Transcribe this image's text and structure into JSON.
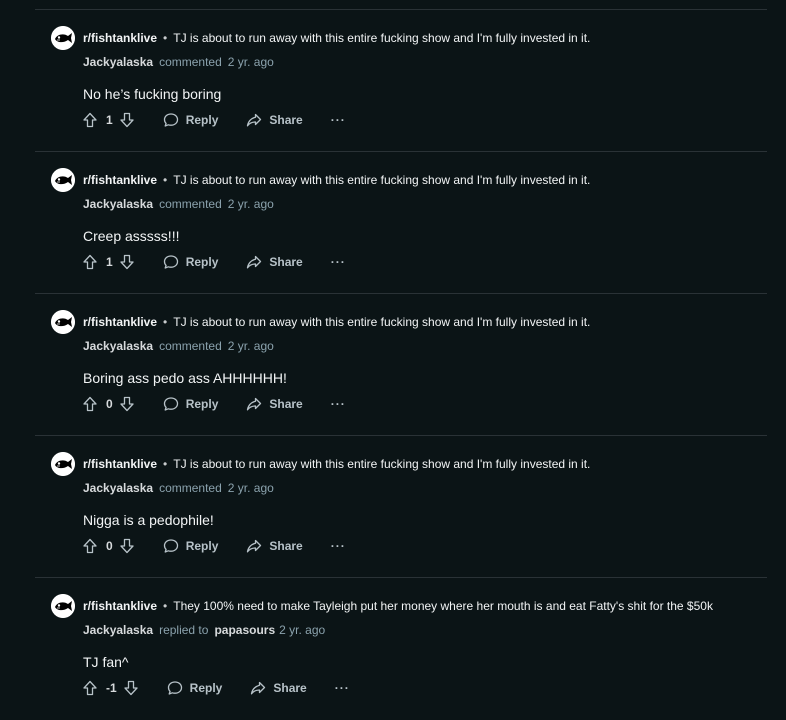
{
  "comments": [
    {
      "subreddit": "r/fishtanklive",
      "post_title": "TJ is about to run away with this entire fucking show and I'm fully invested in it.",
      "author": "Jackyalaska",
      "action": "commented",
      "parent_author": "",
      "time": "2 yr. ago",
      "body": "No he’s fucking boring",
      "score": "1"
    },
    {
      "subreddit": "r/fishtanklive",
      "post_title": "TJ is about to run away with this entire fucking show and I'm fully invested in it.",
      "author": "Jackyalaska",
      "action": "commented",
      "parent_author": "",
      "time": "2 yr. ago",
      "body": "Creep asssss!!!",
      "score": "1"
    },
    {
      "subreddit": "r/fishtanklive",
      "post_title": "TJ is about to run away with this entire fucking show and I'm fully invested in it.",
      "author": "Jackyalaska",
      "action": "commented",
      "parent_author": "",
      "time": "2 yr. ago",
      "body": "Boring ass pedo ass AHHHHHH!",
      "score": "0"
    },
    {
      "subreddit": "r/fishtanklive",
      "post_title": "TJ is about to run away with this entire fucking show and I'm fully invested in it.",
      "author": "Jackyalaska",
      "action": "commented",
      "parent_author": "",
      "time": "2 yr. ago",
      "body": "Nigga is a pedophile!",
      "score": "0"
    },
    {
      "subreddit": "r/fishtanklive",
      "post_title": "They 100% need to make Tayleigh put her money where her mouth is and eat Fatty's shit for the $50k",
      "author": "Jackyalaska",
      "action": "replied to",
      "parent_author": "papasours",
      "time": "2 yr. ago",
      "body": "TJ fan^",
      "score": "-1"
    }
  ],
  "labels": {
    "separator": "•",
    "reply": "Reply",
    "share": "Share",
    "more": "···"
  },
  "icons": {
    "avatar": "fish-avatar-icon",
    "upvote": "upvote-arrow-icon",
    "downvote": "downvote-arrow-icon",
    "reply": "speech-bubble-icon",
    "share": "share-arrow-icon",
    "more": "ellipsis-icon"
  },
  "colors": {
    "background": "#0b1416",
    "divider": "#2a3236",
    "muted_text": "#8ba2ad"
  }
}
